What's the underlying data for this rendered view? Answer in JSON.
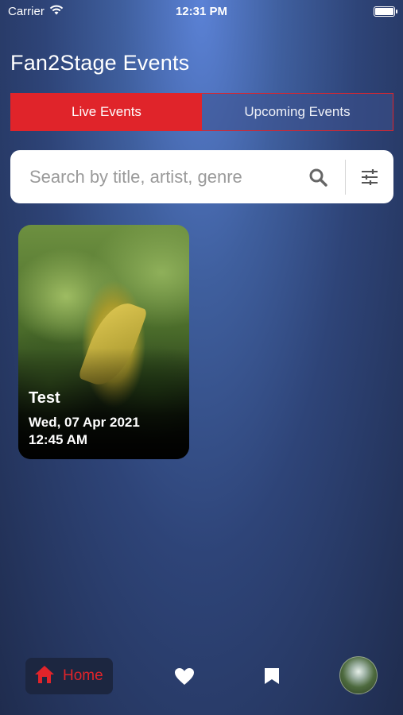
{
  "status_bar": {
    "carrier": "Carrier",
    "time": "12:31 PM"
  },
  "page_title": "Fan2Stage Events",
  "tabs": [
    {
      "label": "Live Events",
      "active": true
    },
    {
      "label": "Upcoming Events",
      "active": false
    }
  ],
  "search": {
    "placeholder": "Search by title, artist, genre",
    "value": ""
  },
  "events": [
    {
      "title": "Test",
      "date": "Wed, 07 Apr 2021",
      "time": "12:45 AM"
    }
  ],
  "nav": {
    "home_label": "Home",
    "accent_color": "#e0242a"
  },
  "icons": {
    "wifi": "wifi-icon",
    "battery": "battery-icon",
    "search": "search-icon",
    "filter": "filter-sliders-icon",
    "home": "home-icon",
    "favorites": "heart-icon",
    "saved": "bookmark-icon",
    "profile": "avatar"
  }
}
